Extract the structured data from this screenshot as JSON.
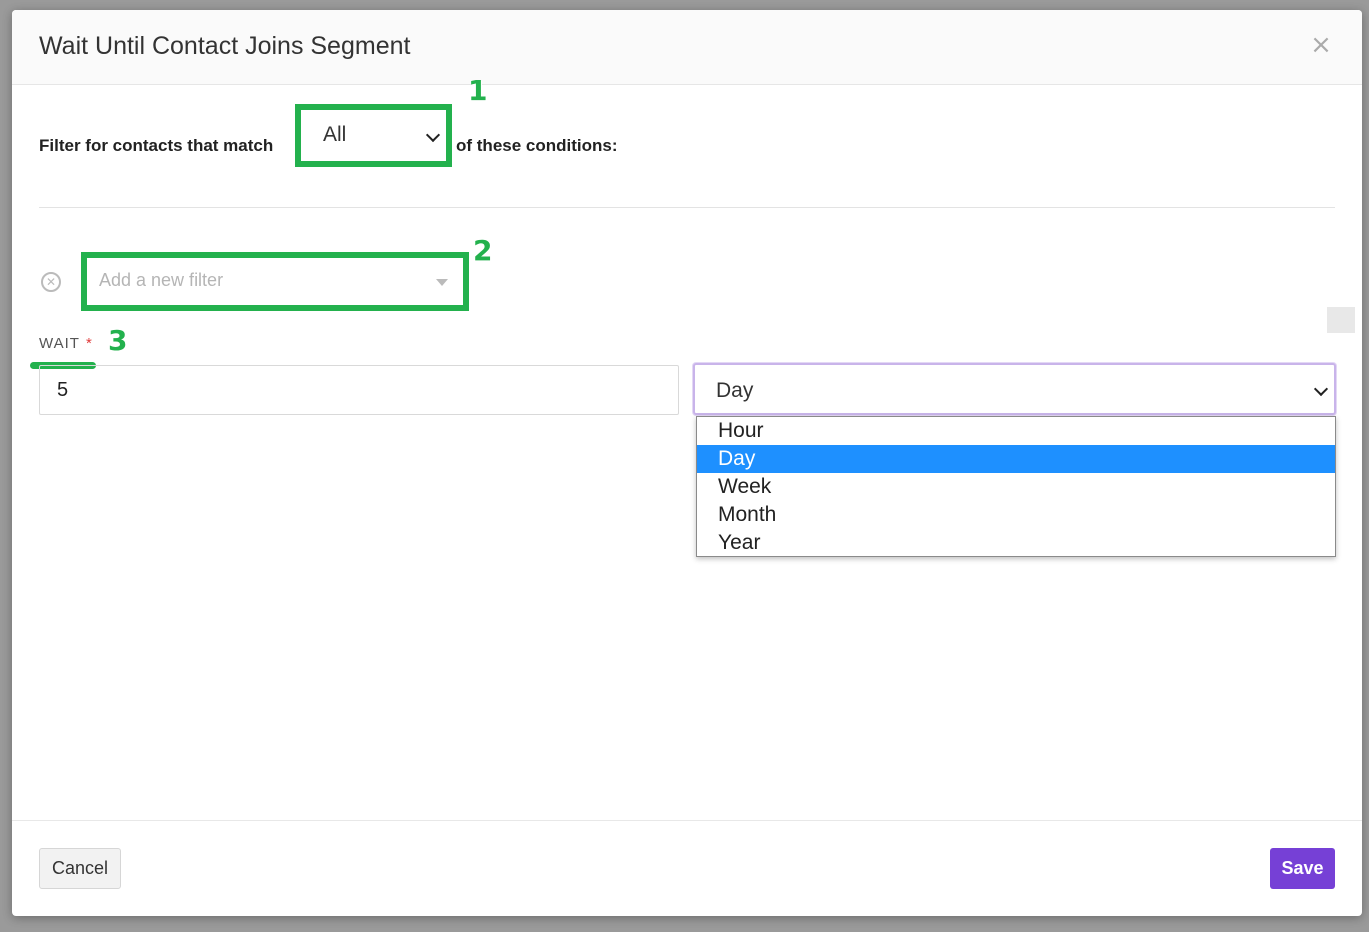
{
  "modal": {
    "title": "Wait Until Contact Joins Segment",
    "close_glyph": "×"
  },
  "filter": {
    "prefix": "Filter for contacts that match",
    "match_value": "All",
    "suffix": "of these conditions:",
    "new_filter_placeholder": "Add a new filter"
  },
  "wait": {
    "label": "WAIT",
    "required_mark": "*",
    "value": "5",
    "unit_selected": "Day",
    "unit_options": [
      "Hour",
      "Day",
      "Week",
      "Month",
      "Year"
    ]
  },
  "annotations": [
    "1",
    "2",
    "3"
  ],
  "footer": {
    "cancel_label": "Cancel",
    "save_label": "Save"
  },
  "colors": {
    "annotation_green": "#23b14d",
    "save_purple": "#7640d6",
    "selected_blue": "#1e90ff",
    "required_red": "#e03b3b"
  }
}
